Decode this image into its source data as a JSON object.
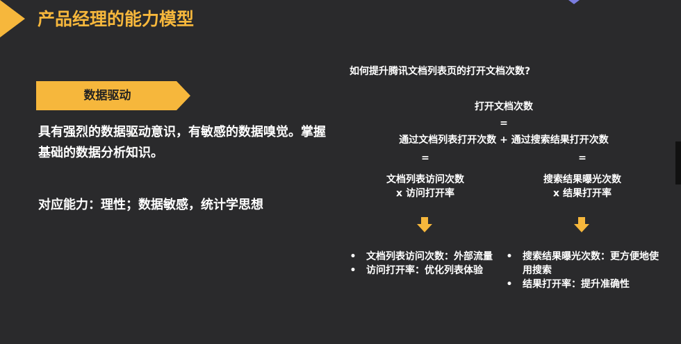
{
  "header": {
    "title": "产品经理的能力模型"
  },
  "left": {
    "tag_label": "数据驱动",
    "description": "具有强烈的数据驱动意识，有敏感的数据嗅觉。掌握基础的数据分析知识。",
    "abilities": "对应能力：理性；数据敏感，统计学思想"
  },
  "right": {
    "question": "如何提升腾讯文档列表页的打开文档次数?",
    "formula": {
      "total": "打开文档次数",
      "eq1": "=",
      "sum": "通过文档列表打开次数 + 通过搜索结果打开次数",
      "eq_left": "=",
      "eq_right": "=",
      "left_line1": "文档列表访问次数",
      "left_line2": "x 访问打开率",
      "right_line1": "搜索结果曝光次数",
      "right_line2": "x 结果打开率"
    },
    "left_bullets": [
      {
        "bullet": "•",
        "text": "文档列表访问次数：外部流量"
      },
      {
        "bullet": "•",
        "text": "访问打开率：优化列表体验"
      }
    ],
    "right_bullets": [
      {
        "bullet": "•",
        "text": "搜索结果曝光次数：更方便地使用搜索"
      },
      {
        "bullet": "•",
        "text": "结果打开率：提升准确性"
      }
    ],
    "arrow_color": "#f6b73c"
  },
  "colors": {
    "background": "#2a2a2c",
    "accent": "#f6b73c"
  }
}
